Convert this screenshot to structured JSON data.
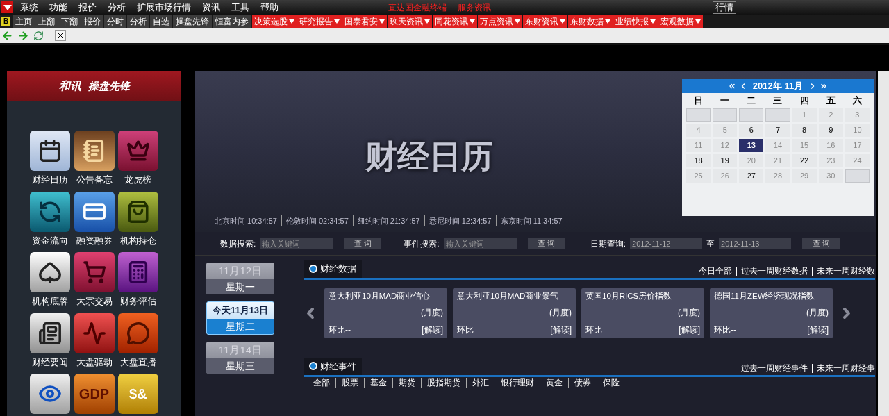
{
  "menu": [
    "系统",
    "功能",
    "报价",
    "分析",
    "扩展市场行情",
    "资讯",
    "工具",
    "帮助"
  ],
  "top_links": [
    "直达国金融终端",
    "服务资讯"
  ],
  "top_button": "行情",
  "toolbar": {
    "badge": "B",
    "buttons": [
      "主页",
      "上翻",
      "下翻",
      "报价",
      "分时",
      "分析",
      "自选",
      "操盘先锋",
      "恒富内参"
    ],
    "dropdowns": [
      "决策选股",
      "研究报告",
      "国泰君安",
      "玖天资讯",
      "同花资讯",
      "万点资讯",
      "东财资讯",
      "东财数据",
      "业绩快报",
      "宏观数据"
    ]
  },
  "sidebar": {
    "brand": "和讯",
    "product": "操盘先锋",
    "tiles": [
      {
        "kind": "calendar",
        "label": "财经日历"
      },
      {
        "kind": "notes",
        "label": "公告备忘"
      },
      {
        "kind": "crown",
        "label": "龙虎榜"
      },
      {
        "kind": "flow",
        "label": "资金流向"
      },
      {
        "kind": "card",
        "label": "融资融券"
      },
      {
        "kind": "bag",
        "label": "机构持仓"
      },
      {
        "kind": "spade",
        "label": "机构底牌"
      },
      {
        "kind": "cart",
        "label": "大宗交易"
      },
      {
        "kind": "calc",
        "label": "财务评估"
      },
      {
        "kind": "news",
        "label": "财经要闻"
      },
      {
        "kind": "pulse",
        "label": "大盘驱动"
      },
      {
        "kind": "chat",
        "label": "大盘直播"
      },
      {
        "kind": "eye"
      },
      {
        "kind": "gdp",
        "glyph": "GDP"
      },
      {
        "kind": "money",
        "glyph": "$&"
      }
    ]
  },
  "banner": {
    "title": "财经日历",
    "times": [
      {
        "city": "北京时间",
        "time": "10:34:57"
      },
      {
        "city": "伦敦时间",
        "time": "02:34:57"
      },
      {
        "city": "纽约时间",
        "time": "21:34:57"
      },
      {
        "city": "悉尼时间",
        "time": "12:34:57"
      },
      {
        "city": "东京时间",
        "time": "11:34:57"
      }
    ]
  },
  "calendar": {
    "title": "2012年 11月",
    "weekdays": [
      "日",
      "一",
      "二",
      "三",
      "四",
      "五",
      "六"
    ],
    "days": [
      {
        "kind": "blank"
      },
      {
        "kind": "blank"
      },
      {
        "kind": "blank"
      },
      {
        "kind": "blank"
      },
      {
        "kind": "day",
        "day": "1",
        "enabled": false,
        "selected": false
      },
      {
        "kind": "day",
        "day": "2",
        "enabled": false,
        "selected": false
      },
      {
        "kind": "day",
        "day": "3",
        "enabled": false,
        "selected": false
      },
      {
        "kind": "day",
        "day": "4",
        "enabled": false,
        "selected": false
      },
      {
        "kind": "day",
        "day": "5",
        "enabled": false,
        "selected": false
      },
      {
        "kind": "day",
        "day": "6",
        "enabled": true,
        "selected": false
      },
      {
        "kind": "day",
        "day": "7",
        "enabled": true,
        "selected": false
      },
      {
        "kind": "day",
        "day": "8",
        "enabled": true,
        "selected": false
      },
      {
        "kind": "day",
        "day": "9",
        "enabled": true,
        "selected": false
      },
      {
        "kind": "day",
        "day": "10",
        "enabled": false,
        "selected": false
      },
      {
        "kind": "day",
        "day": "11",
        "enabled": false,
        "selected": false
      },
      {
        "kind": "day",
        "day": "12",
        "enabled": false,
        "selected": false
      },
      {
        "kind": "day",
        "day": "13",
        "enabled": true,
        "selected": true
      },
      {
        "kind": "day",
        "day": "14",
        "enabled": false,
        "selected": false
      },
      {
        "kind": "day",
        "day": "15",
        "enabled": false,
        "selected": false
      },
      {
        "kind": "day",
        "day": "16",
        "enabled": false,
        "selected": false
      },
      {
        "kind": "day",
        "day": "17",
        "enabled": false,
        "selected": false
      },
      {
        "kind": "day",
        "day": "18",
        "enabled": true,
        "selected": false
      },
      {
        "kind": "day",
        "day": "19",
        "enabled": true,
        "selected": false
      },
      {
        "kind": "day",
        "day": "20",
        "enabled": false,
        "selected": false
      },
      {
        "kind": "day",
        "day": "21",
        "enabled": false,
        "selected": false
      },
      {
        "kind": "day",
        "day": "22",
        "enabled": true,
        "selected": false
      },
      {
        "kind": "day",
        "day": "23",
        "enabled": false,
        "selected": false
      },
      {
        "kind": "day",
        "day": "24",
        "enabled": false,
        "selected": false
      },
      {
        "kind": "day",
        "day": "25",
        "enabled": false,
        "selected": false
      },
      {
        "kind": "day",
        "day": "26",
        "enabled": false,
        "selected": false
      },
      {
        "kind": "day",
        "day": "27",
        "enabled": true,
        "selected": false
      },
      {
        "kind": "day",
        "day": "28",
        "enabled": false,
        "selected": false
      },
      {
        "kind": "day",
        "day": "29",
        "enabled": false,
        "selected": false
      },
      {
        "kind": "day",
        "day": "30",
        "enabled": false,
        "selected": false
      },
      {
        "kind": "blank"
      }
    ]
  },
  "search": {
    "data_label": "数据搜索:",
    "data_placeholder": "输入关键词",
    "data_button": "查 询",
    "event_label": "事件搜索:",
    "event_placeholder": "输入关键词",
    "event_button": "查 询",
    "date_label": "日期查询:",
    "date_from": "2012-11-12",
    "date_sep": "至",
    "date_to": "2012-11-13",
    "date_button": "查 询"
  },
  "dates": [
    {
      "date": "11月12日",
      "weekday": "星期一",
      "selected": false
    },
    {
      "date": "今天11月13日",
      "weekday": "星期二",
      "selected": true
    },
    {
      "date": "11月14日",
      "weekday": "星期三",
      "selected": false
    }
  ],
  "data_section": {
    "title": "财经数据",
    "links": [
      "今日全部",
      "过去一周财经数据",
      "未来一周财经数"
    ],
    "cards": [
      {
        "title": "意大利亚10月MAD商业信心",
        "period": "(月度)",
        "change": "环比--",
        "read": "[解读]"
      },
      {
        "title": "意大利亚10月MAD商业景气",
        "period": "(月度)",
        "change": "环比",
        "read": "[解读]"
      },
      {
        "title": "英国10月RICS房价指数",
        "period": "(月度)",
        "change": "环比",
        "read": "[解读]"
      },
      {
        "title": "德国11月ZEW经济现况指数",
        "value": "—",
        "period": "(月度)",
        "change": "环比--",
        "read": "[解读]"
      }
    ]
  },
  "event_section": {
    "title": "财经事件",
    "links": [
      "过去一周财经事件",
      "未来一周财经事"
    ],
    "tabs": [
      "全部",
      "股票",
      "基金",
      "期货",
      "股指期货",
      "外汇",
      "银行理财",
      "黄金",
      "债券",
      "保险"
    ]
  }
}
